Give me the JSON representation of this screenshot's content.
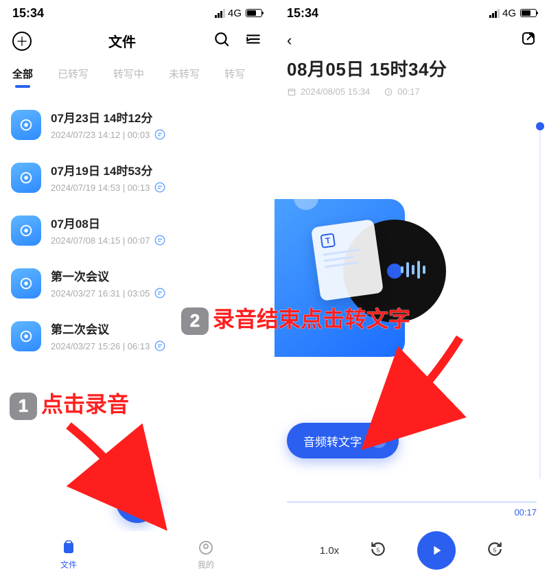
{
  "status": {
    "time": "15:34",
    "network": "4G"
  },
  "left": {
    "header_title": "文件",
    "tabs": [
      "全部",
      "已转写",
      "转写中",
      "未转写",
      "转写"
    ],
    "active_tab_index": 0,
    "items": [
      {
        "title": "07月23日 14时12分",
        "sub": "2024/07/23 14:12 | 00:03"
      },
      {
        "title": "07月19日 14时53分",
        "sub": "2024/07/19 14:53 | 00:13"
      },
      {
        "title": "07月08日",
        "sub": "2024/07/08 14:15 | 00:07"
      },
      {
        "title": "第一次会议",
        "sub": "2024/03/27 16:31 | 03:05"
      },
      {
        "title": "第二次会议",
        "sub": "2024/03/27 15:26 | 06:13"
      }
    ],
    "nav": {
      "files": "文件",
      "mine": "我的"
    }
  },
  "right": {
    "title": "08月05日 15时34分",
    "date_text": "2024/08/05 15:34",
    "duration_text": "00:17",
    "convert_label": "音频转文字",
    "playback_time": "00:17",
    "speed": "1.0x",
    "skip_seconds": "5"
  },
  "annotations": {
    "step1": "点击录音",
    "step2": "录音结束点击转文字",
    "badge1": "1",
    "badge2": "2"
  }
}
